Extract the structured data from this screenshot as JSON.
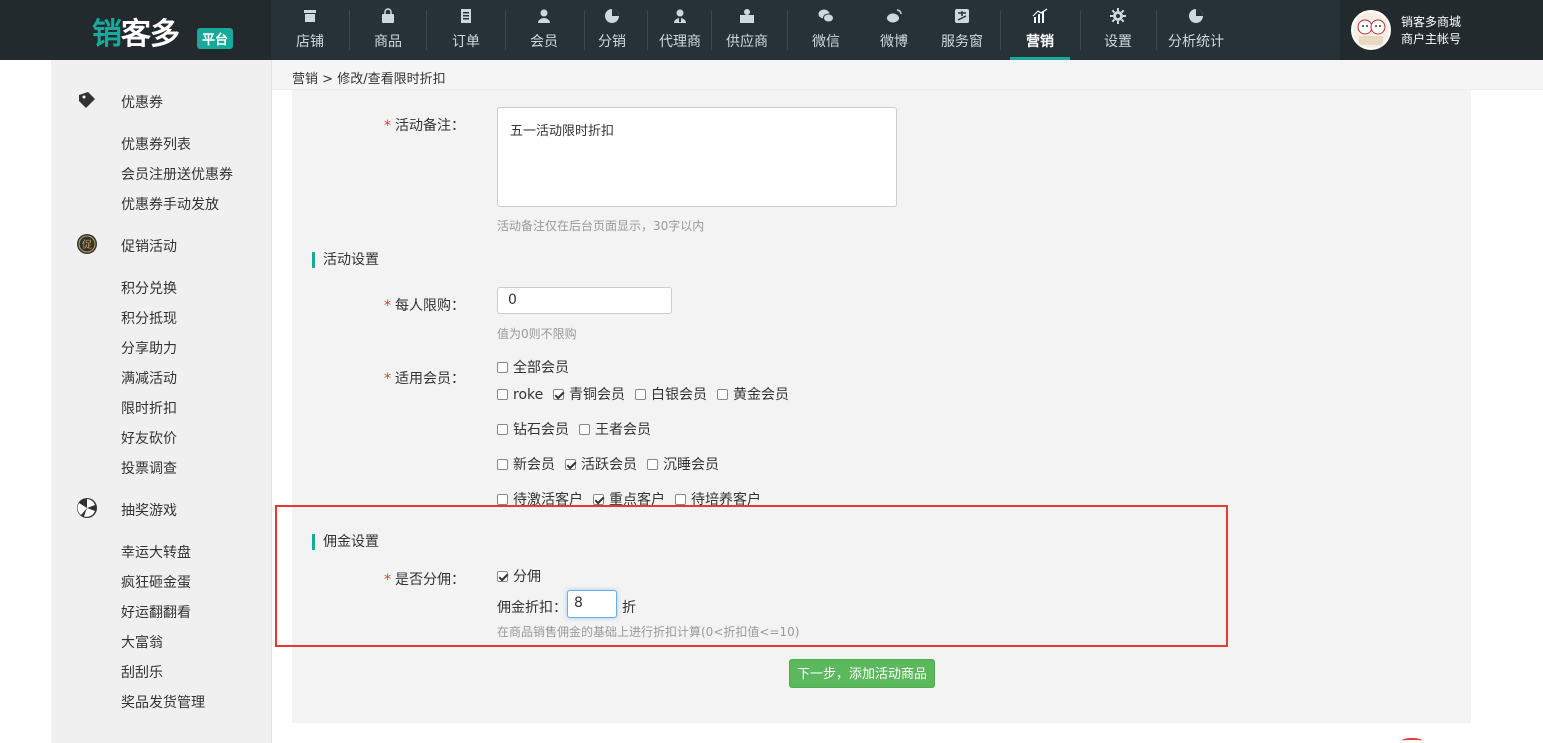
{
  "brand": {
    "logo_main": "销客多",
    "logo_badge": "平台"
  },
  "nav": {
    "items": [
      {
        "label": "店铺",
        "icon": "shop-icon"
      },
      {
        "label": "商品",
        "icon": "bag-icon"
      },
      {
        "label": "订单",
        "icon": "document-icon"
      },
      {
        "label": "会员",
        "icon": "user-icon"
      },
      {
        "label": "分销",
        "icon": "pie-icon"
      },
      {
        "label": "代理商",
        "icon": "agent-icon"
      },
      {
        "label": "供应商",
        "icon": "supplier-icon"
      },
      {
        "label": "微信",
        "icon": "wechat-icon"
      },
      {
        "label": "微博",
        "icon": "weibo-icon"
      },
      {
        "label": "服务窗",
        "icon": "alipay-icon"
      },
      {
        "label": "营销",
        "icon": "chart-icon"
      },
      {
        "label": "设置",
        "icon": "gear-icon"
      },
      {
        "label": "分析统计",
        "icon": "stats-pie-icon"
      }
    ],
    "active": "营销"
  },
  "account": {
    "name": "销客多商城",
    "role": "商户主帐号"
  },
  "sidebar": {
    "groups": [
      {
        "label": "优惠券",
        "icon": "coupon-icon",
        "items": [
          "优惠券列表",
          "会员注册送优惠券",
          "优惠券手动发放"
        ]
      },
      {
        "label": "促销活动",
        "icon": "promotion-icon",
        "items": [
          "积分兑换",
          "积分抵现",
          "分享助力",
          "满减活动",
          "限时折扣",
          "好友砍价",
          "投票调查"
        ]
      },
      {
        "label": "抽奖游戏",
        "icon": "lottery-icon",
        "items": [
          "幸运大转盘",
          "疯狂砸金蛋",
          "好运翻翻看",
          "大富翁",
          "刮刮乐",
          "奖品发货管理"
        ]
      }
    ]
  },
  "breadcrumb": {
    "parent": "营销",
    "sep": " > ",
    "current": "修改/查看限时折扣"
  },
  "form": {
    "remark": {
      "label": "活动备注：",
      "value": "五一活动限时折扣",
      "hint": "活动备注仅在后台页面显示，30字以内"
    },
    "activity_section": "活动设置",
    "limit": {
      "label": "每人限购：",
      "value": "0",
      "hint": "值为0则不限购"
    },
    "members": {
      "label": "适用会员：",
      "options": [
        {
          "label": "全部会员",
          "checked": false
        },
        {
          "label": "roke",
          "checked": false
        },
        {
          "label": "青铜会员",
          "checked": true
        },
        {
          "label": "白银会员",
          "checked": false
        },
        {
          "label": "黄金会员",
          "checked": false
        },
        {
          "label": "钻石会员",
          "checked": false
        },
        {
          "label": "王者会员",
          "checked": false
        },
        {
          "label": "新会员",
          "checked": false
        },
        {
          "label": "活跃会员",
          "checked": true
        },
        {
          "label": "沉睡会员",
          "checked": false
        },
        {
          "label": "待激活客户",
          "checked": false
        },
        {
          "label": "重点客户",
          "checked": true
        },
        {
          "label": "待培养客户",
          "checked": false
        }
      ]
    },
    "commission_section": "佣金设置",
    "commission": {
      "label": "是否分佣：",
      "enable_label": "分佣",
      "enabled": true,
      "discount_label": "佣金折扣：",
      "discount_value": "8",
      "discount_unit": "折",
      "hint": "在商品销售佣金的基础上进行折扣计算(0<折扣值<=10)"
    },
    "submit_label": "下一步，添加活动商品"
  },
  "colors": {
    "accent": "#19a99a",
    "highlight": "#e53935",
    "button": "#5cb85c",
    "topbar": "#263238"
  }
}
